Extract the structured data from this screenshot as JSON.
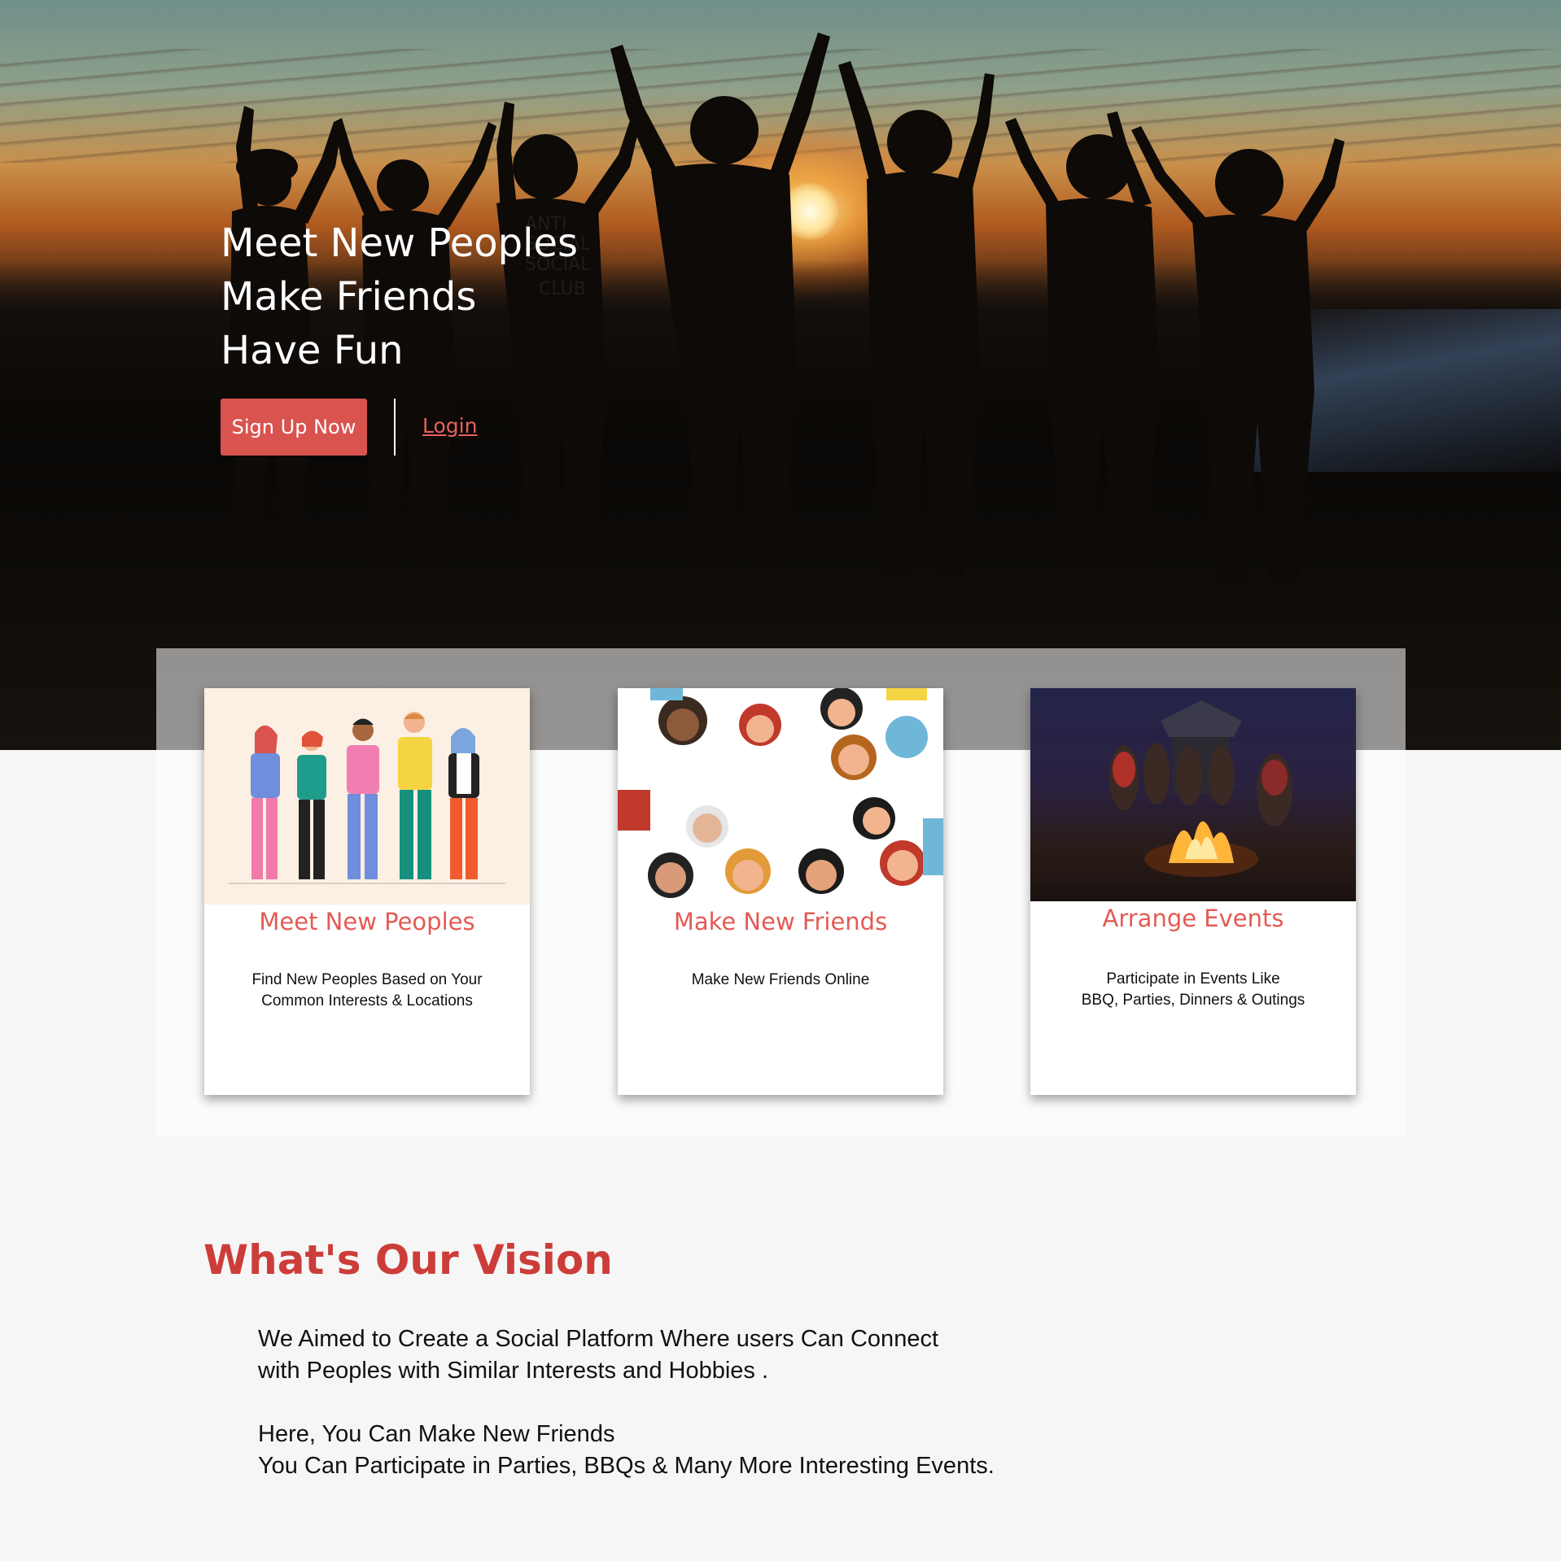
{
  "hero": {
    "lines": [
      "Meet New Peoples",
      "Make Friends",
      "Have Fun"
    ],
    "signup_label": "Sign Up Now",
    "login_label": "Login",
    "shirt_text": [
      "ANTI",
      "SOCIAL",
      "SOCIAL",
      "CLUB"
    ]
  },
  "cards": [
    {
      "title": "Meet New Peoples",
      "desc": "Find New Peoples Based on Your\nCommon Interests & Locations",
      "image": "group-illustration"
    },
    {
      "title": "Make New Friends",
      "desc": "Make New Friends Online",
      "image": "friends-circle-illustration"
    },
    {
      "title": "Arrange Events",
      "desc": "Participate in Events Like\nBBQ, Parties, Dinners & Outings",
      "image": "campfire-photo"
    }
  ],
  "vision": {
    "title": "What's Our Vision",
    "body": "We Aimed to Create a Social Platform Where users Can Connect\nwith Peoples with Similar Interests and Hobbies .\n\nHere, You Can Make New Friends\nYou Can Participate in Parties, BBQs & Many More Interesting Events."
  },
  "colors": {
    "accent": "#d9534f",
    "title_red": "#e35a55",
    "vision_red": "#cc3d3a"
  }
}
